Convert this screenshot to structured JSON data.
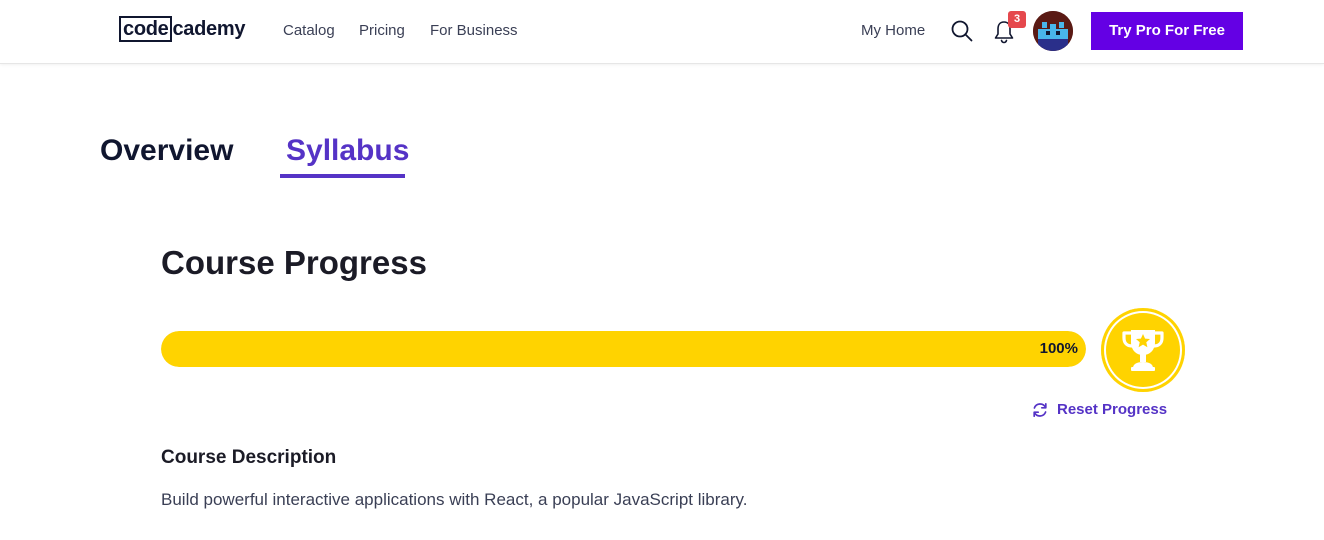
{
  "brand": {
    "logo_boxed": "code",
    "logo_rest": "cademy",
    "accent_color": "#6400e4",
    "syllabus_color": "#5533c6",
    "progress_color": "#ffd300"
  },
  "nav": {
    "links": [
      "Catalog",
      "Pricing",
      "For Business"
    ],
    "my_home": "My Home",
    "search_icon": "search-icon",
    "notification_icon": "bell-icon",
    "notification_count": "3",
    "cta": "Try Pro For Free"
  },
  "tabs": [
    {
      "label": "Overview",
      "active": false
    },
    {
      "label": "Syllabus",
      "active": true
    }
  ],
  "progress": {
    "title": "Course Progress",
    "value_fraction": 1.0,
    "value_label": "100%",
    "reset_label": "Reset Progress",
    "trophy_icon": "trophy-icon",
    "reset_icon": "refresh-icon"
  },
  "description": {
    "title": "Course Description",
    "text": "Build powerful interactive applications with React, a popular JavaScript library."
  }
}
